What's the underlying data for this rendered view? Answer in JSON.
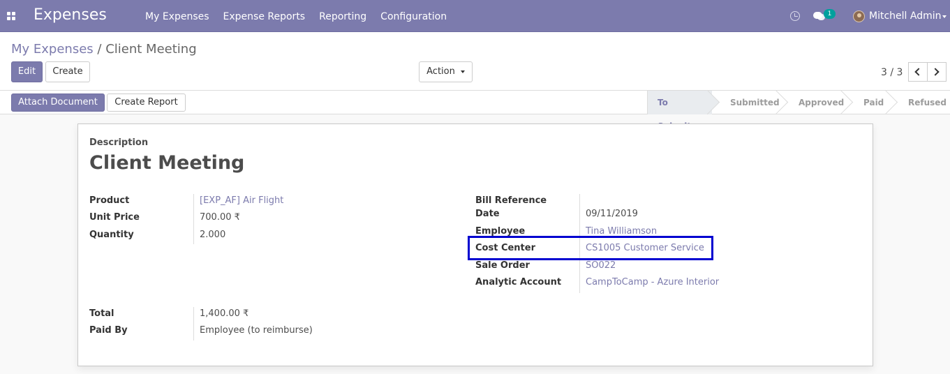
{
  "navbar": {
    "app_title": "Expenses",
    "menu": [
      "My Expenses",
      "Expense Reports",
      "Reporting",
      "Configuration"
    ],
    "notification_count": "1",
    "user_name": "Mitchell Admin",
    "accent_color": "#7c7bad"
  },
  "breadcrumb": {
    "parent": "My Expenses",
    "separator": "/",
    "current": "Client Meeting"
  },
  "toolbar": {
    "edit_label": "Edit",
    "create_label": "Create",
    "action_label": "Action",
    "pager": "3 / 3"
  },
  "statusbar": {
    "attach_label": "Attach Document",
    "create_report_label": "Create Report",
    "stages": [
      "To Submit",
      "Submitted",
      "Approved",
      "Paid",
      "Refused"
    ],
    "active_stage": "To Submit"
  },
  "form": {
    "description_label": "Description",
    "title": "Client Meeting",
    "left": [
      {
        "label": "Product",
        "value": "[EXP_AF] Air Flight",
        "link": true
      },
      {
        "label": "Unit Price",
        "value": "700.00 ₹",
        "link": false
      },
      {
        "label": "Quantity",
        "value": "2.000",
        "link": false
      }
    ],
    "right": [
      {
        "label": "Bill Reference",
        "value": "",
        "link": false
      },
      {
        "label": "Date",
        "value": "09/11/2019",
        "link": false
      },
      {
        "label": "Employee",
        "value": "Tina Williamson",
        "link": true
      },
      {
        "label": "Cost Center",
        "value": "CS1005 Customer Service",
        "link": true
      },
      {
        "label": "Sale Order",
        "value": "SO022",
        "link": true
      },
      {
        "label": "Analytic Account",
        "value": "CampToCamp - Azure Interior",
        "link": true
      }
    ],
    "bottom": [
      {
        "label": "Total",
        "value": "1,400.00 ₹",
        "link": false
      },
      {
        "label": "Paid By",
        "value": "Employee (to reimburse)",
        "link": false
      }
    ],
    "highlight_color": "#0000d0"
  }
}
